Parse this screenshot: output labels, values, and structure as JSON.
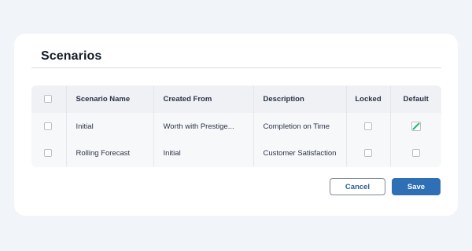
{
  "dialog": {
    "title": "Scenarios"
  },
  "table": {
    "columns": [
      "Scenario Name",
      "Created From",
      "Description",
      "Locked",
      "Default"
    ],
    "rows": [
      {
        "name": "Initial",
        "created_from": "Worth with Prestige...",
        "description": "Completion on Time",
        "locked": false,
        "default_icon": "pencil-edit-icon"
      },
      {
        "name": "Rolling Forecast",
        "created_from": "Initial",
        "description": "Customer Satisfaction",
        "locked": false,
        "default": false
      }
    ]
  },
  "actions": {
    "cancel_label": "Cancel",
    "save_label": "Save"
  },
  "colors": {
    "primary": "#2f6fb5",
    "accent_green": "#22b573"
  }
}
